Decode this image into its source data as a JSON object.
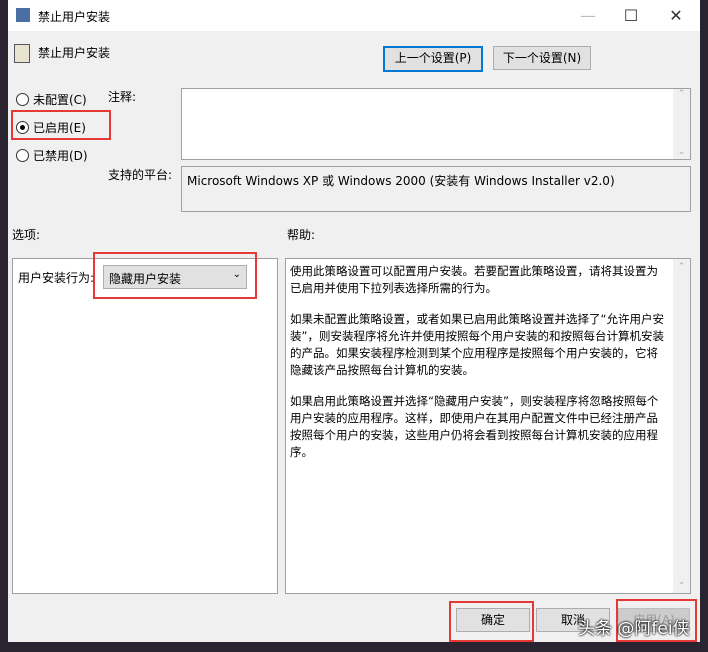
{
  "window": {
    "title": "禁止用户安装",
    "minimize": "—",
    "maximize": "☐",
    "close": "✕"
  },
  "header": {
    "policy_name": "禁止用户安装",
    "prev_button": "上一个设置(P)",
    "next_button": "下一个设置(N)"
  },
  "state": {
    "options": [
      {
        "label": "未配置(C)",
        "selected": false
      },
      {
        "label": "已启用(E)",
        "selected": true
      },
      {
        "label": "已禁用(D)",
        "selected": false
      }
    ]
  },
  "comment": {
    "label": "注释:",
    "value": ""
  },
  "platform": {
    "label": "支持的平台:",
    "value": "Microsoft Windows XP 或 Windows 2000 (安装有 Windows Installer v2.0)"
  },
  "options_panel": {
    "label": "选项:",
    "field_label": "用户安装行为:",
    "selected_value": "隐藏用户安装"
  },
  "help_panel": {
    "label": "帮助:",
    "paragraphs": [
      "使用此策略设置可以配置用户安装。若要配置此策略设置，请将其设置为已启用并使用下拉列表选择所需的行为。",
      "如果未配置此策略设置，或者如果已启用此策略设置并选择了“允许用户安装”，则安装程序将允许并使用按照每个用户安装的和按照每台计算机安装的产品。如果安装程序检测到某个应用程序是按照每个用户安装的，它将隐藏该产品按照每台计算机的安装。",
      "如果启用此策略设置并选择“隐藏用户安装”，则安装程序将忽略按照每个用户安装的应用程序。这样，即使用户在其用户配置文件中已经注册产品按照每个用户的安装，这些用户仍将会看到按照每台计算机安装的应用程序。"
    ]
  },
  "footer": {
    "ok": "确定",
    "cancel": "取消",
    "apply": "应用(A)"
  },
  "watermark": "头条 @阿fei侠"
}
